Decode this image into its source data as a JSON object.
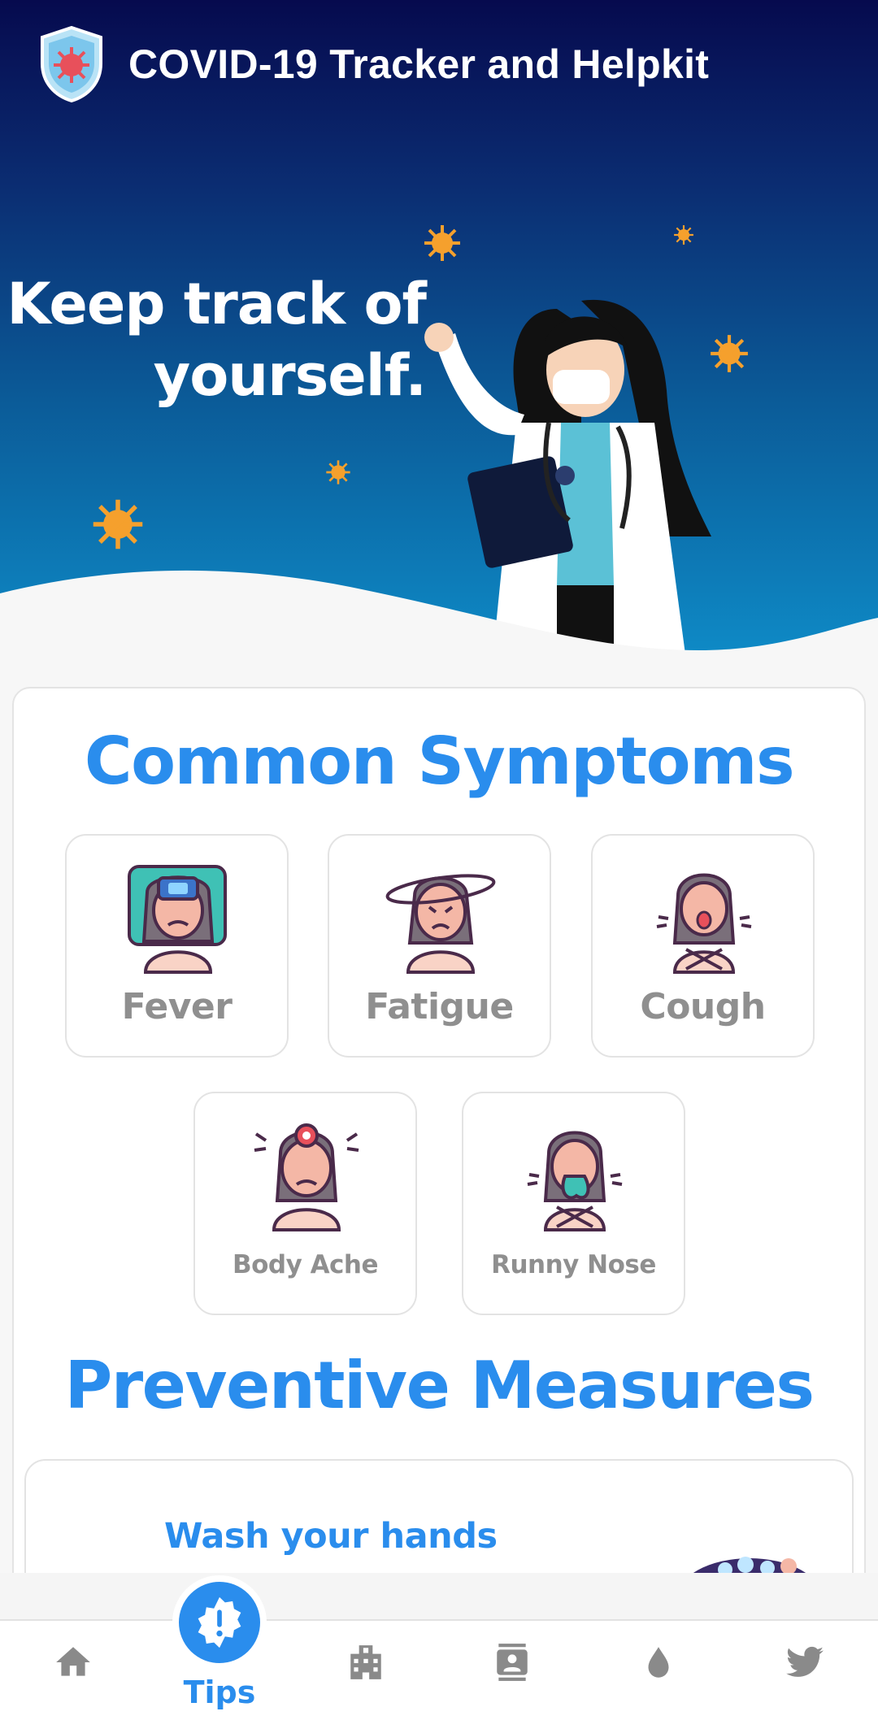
{
  "app": {
    "title": "COVID-19 Tracker and Helpkit",
    "logo_icon": "shield-virus-icon"
  },
  "hero": {
    "line1": "Keep track of",
    "line2": "yourself."
  },
  "symptoms": {
    "title": "Common Symptoms",
    "items": [
      {
        "label": "Fever",
        "icon": "fever-icon"
      },
      {
        "label": "Fatigue",
        "icon": "fatigue-icon"
      },
      {
        "label": "Cough",
        "icon": "cough-icon"
      },
      {
        "label": "Body Ache",
        "icon": "body-ache-icon"
      },
      {
        "label": "Runny Nose",
        "icon": "runny-nose-icon"
      }
    ]
  },
  "prevention": {
    "title": "Preventive Measures",
    "first_card_title": "Wash your hands"
  },
  "nav": {
    "items": [
      {
        "id": "home",
        "icon": "home-icon",
        "active": false
      },
      {
        "id": "tips",
        "icon": "alert-badge-icon",
        "label": "Tips",
        "active": true
      },
      {
        "id": "hospitals",
        "icon": "hospital-icon",
        "active": false
      },
      {
        "id": "contacts",
        "icon": "contact-book-icon",
        "active": false
      },
      {
        "id": "blood",
        "icon": "blood-drop-icon",
        "active": false
      },
      {
        "id": "twitter",
        "icon": "twitter-icon",
        "active": false
      }
    ]
  },
  "colors": {
    "accent": "#2a8ded",
    "hero_top": "#060a4e",
    "hero_bottom": "#0e8cc8",
    "virus_orange": "#f5a02d",
    "nav_icon": "#8a8a8a"
  }
}
